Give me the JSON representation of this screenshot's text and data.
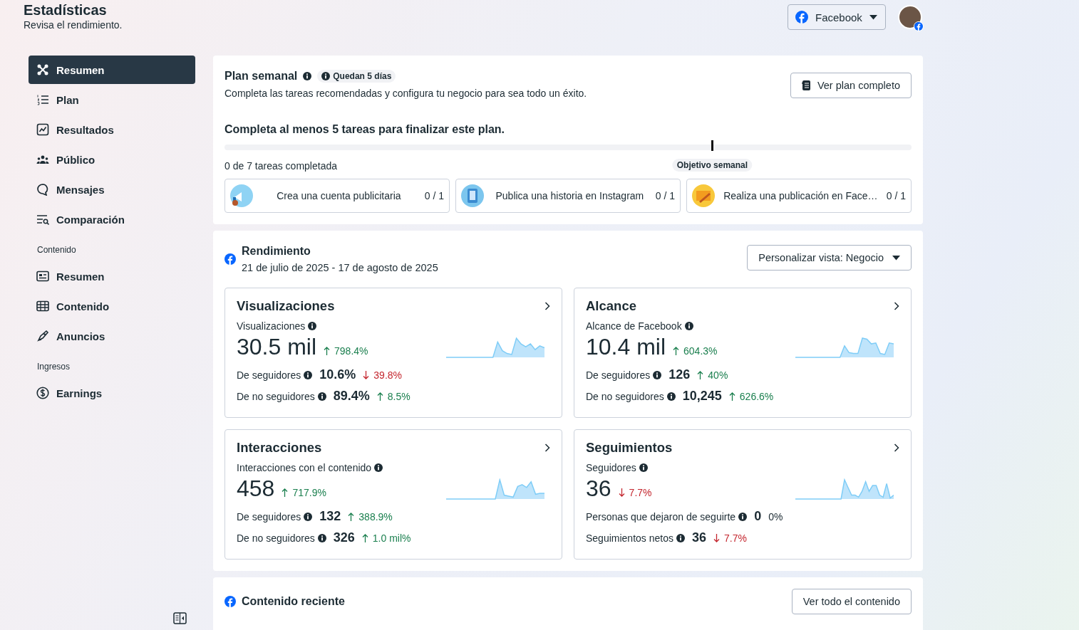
{
  "header": {
    "title": "Estadísticas",
    "subtitle": "Revisa el rendimiento.",
    "account_button": "Facebook"
  },
  "sidebar": {
    "items": [
      {
        "kind": "item",
        "label": "Resumen",
        "selected": true
      },
      {
        "kind": "item",
        "label": "Plan",
        "selected": false
      },
      {
        "kind": "item",
        "label": "Resultados",
        "selected": false
      },
      {
        "kind": "item",
        "label": "Público",
        "selected": false
      },
      {
        "kind": "item",
        "label": "Mensajes",
        "selected": false
      },
      {
        "kind": "item",
        "label": "Comparación",
        "selected": false
      },
      {
        "kind": "section",
        "label": "Contenido"
      },
      {
        "kind": "item",
        "label": "Resumen",
        "selected": false
      },
      {
        "kind": "item",
        "label": "Contenido",
        "selected": false
      },
      {
        "kind": "item",
        "label": "Anuncios",
        "selected": false
      },
      {
        "kind": "section",
        "label": "Ingresos"
      },
      {
        "kind": "item",
        "label": "Earnings",
        "selected": false
      }
    ]
  },
  "weekly_plan": {
    "title": "Plan semanal",
    "badge": "Quedan 5 días",
    "description": "Completa las tareas recomendadas y configura tu negocio para sea todo un éxito.",
    "button": "Ver plan completo",
    "goal_text": "Completa al menos 5 tareas para finalizar este plan.",
    "progress": {
      "level": 0,
      "label": "0 de 7 tareas completada",
      "goal_label": "Objetivo semanal"
    },
    "tasks": [
      {
        "label": "Crea una cuenta publicitaria",
        "count": "0 / 1"
      },
      {
        "label": "Publica una historia en Instagram",
        "count": "0 / 1"
      },
      {
        "label": "Realiza una publicación en Face…",
        "count": "0 / 1"
      }
    ]
  },
  "performance": {
    "title": "Rendimiento",
    "date_range": "21 de julio de 2025 - 17 de agosto de 2025",
    "view_dropdown": "Personalizar vista: Negocio",
    "cards": [
      {
        "title": "Visualizaciones",
        "metric_label": "Visualizaciones",
        "value": "30.5 mil",
        "change": {
          "text": "798.4%",
          "kind": "up"
        },
        "rows": [
          {
            "label": "De seguidores",
            "value": "10.6%",
            "change": {
              "text": "39.8%",
              "kind": "down"
            }
          },
          {
            "label": "De no seguidores",
            "value": "89.4%",
            "change": {
              "text": "8.5%",
              "kind": "up"
            }
          }
        ]
      },
      {
        "title": "Alcance",
        "metric_label": "Alcance de Facebook",
        "value": "10.4 mil",
        "change": {
          "text": "604.3%",
          "kind": "up"
        },
        "rows": [
          {
            "label": "De seguidores",
            "value": "126",
            "change": {
              "text": "40%",
              "kind": "up"
            }
          },
          {
            "label": "De no seguidores",
            "value": "10,245",
            "change": {
              "text": "626.6%",
              "kind": "up"
            }
          }
        ]
      },
      {
        "title": "Interacciones",
        "metric_label": "Interacciones con el contenido",
        "value": "458",
        "change": {
          "text": "717.9%",
          "kind": "up"
        },
        "rows": [
          {
            "label": "De seguidores",
            "value": "132",
            "change": {
              "text": "388.9%",
              "kind": "up"
            }
          },
          {
            "label": "De no seguidores",
            "value": "326",
            "change": {
              "text": "1.0 mil%",
              "kind": "up"
            }
          }
        ]
      },
      {
        "title": "Seguimientos",
        "metric_label": "Seguidores",
        "value": "36",
        "change": {
          "text": "7.7%",
          "kind": "down"
        },
        "rows": [
          {
            "label": "Personas que dejaron de seguirte",
            "value": "0",
            "change": {
              "text": "0%",
              "kind": "flat"
            }
          },
          {
            "label": "Seguimientos netos",
            "value": "36",
            "change": {
              "text": "7.7%",
              "kind": "down"
            }
          }
        ]
      }
    ]
  },
  "recent_content": {
    "title": "Contenido reciente",
    "button": "Ver todo el contenido"
  }
}
